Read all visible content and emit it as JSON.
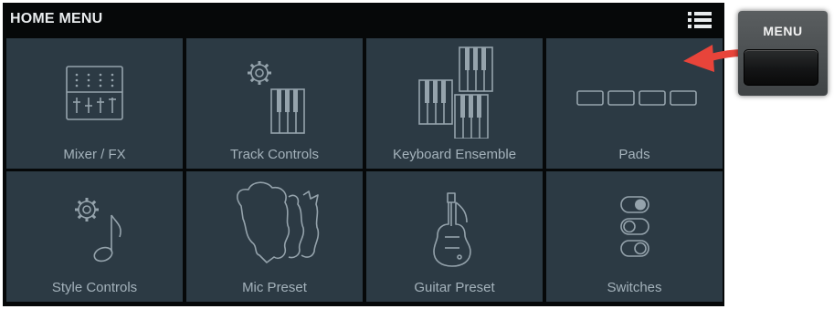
{
  "header": {
    "title": "HOME MENU",
    "menu_icon": "list-icon"
  },
  "tiles": [
    {
      "label": "Mixer / FX",
      "icon": "mixer-icon"
    },
    {
      "label": "Track Controls",
      "icon": "track-controls-icon"
    },
    {
      "label": "Keyboard Ensemble",
      "icon": "keyboard-ensemble-icon"
    },
    {
      "label": "Pads",
      "icon": "pads-icon"
    },
    {
      "label": "Style Controls",
      "icon": "style-controls-icon"
    },
    {
      "label": "Mic Preset",
      "icon": "mic-preset-icon"
    },
    {
      "label": "Guitar Preset",
      "icon": "guitar-icon"
    },
    {
      "label": "Switches",
      "icon": "switches-icon"
    }
  ],
  "hardware": {
    "label": "MENU",
    "button": "menu-hardware-button"
  },
  "colors": {
    "background": "#060809",
    "tile": "#2c3a44",
    "label_text": "#a4b2bb",
    "icon_stroke": "#95a3ac",
    "arrow": "#e8443a"
  }
}
